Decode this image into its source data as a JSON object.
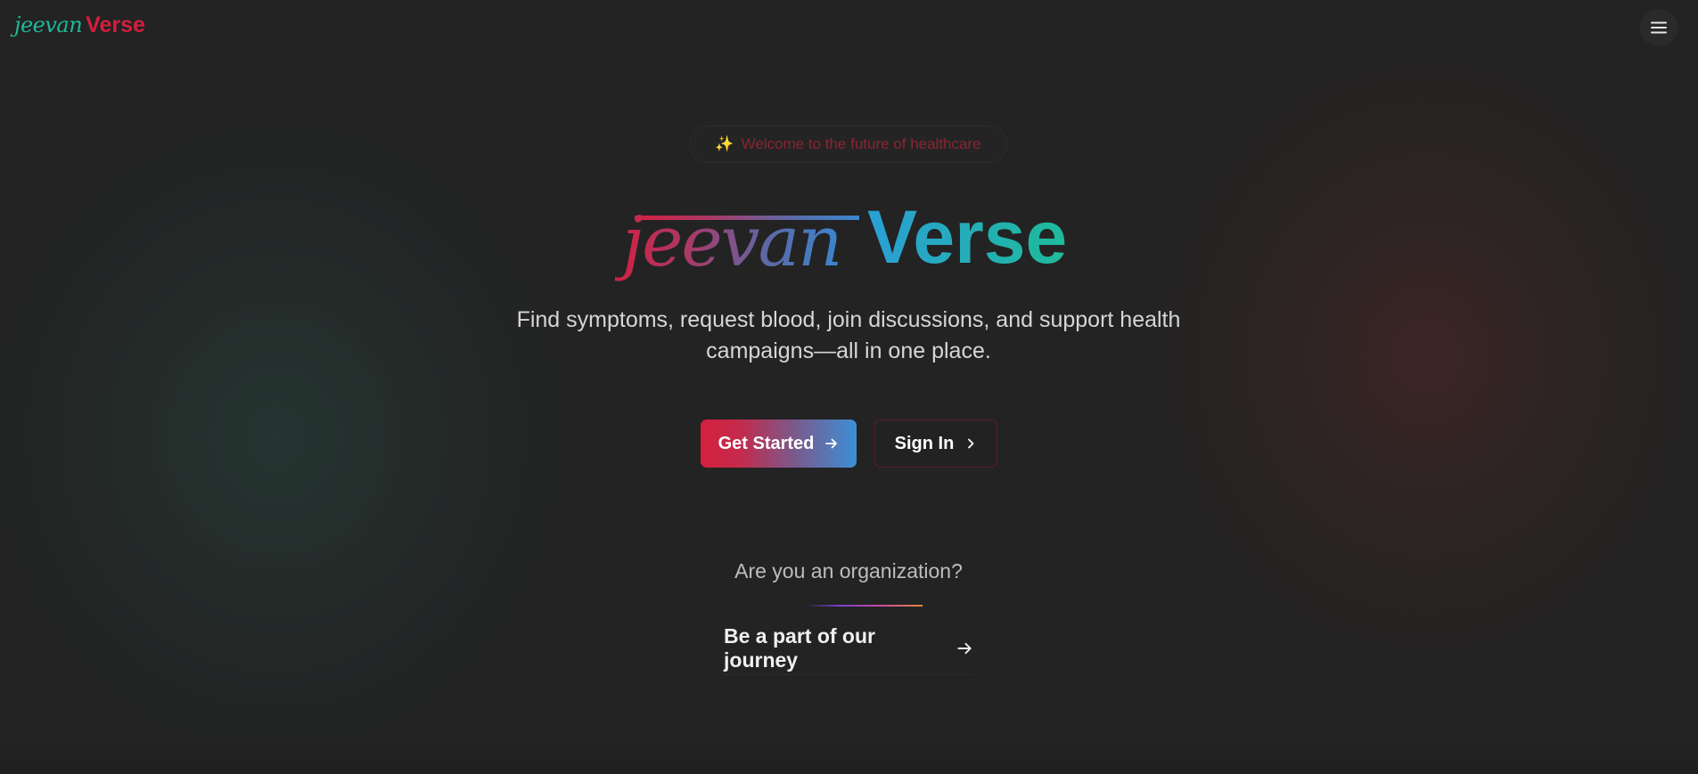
{
  "header": {
    "brand_part1": "jeevan",
    "brand_part2": "Verse",
    "menu_icon": "hamburger-menu-icon"
  },
  "hero": {
    "badge_icon": "sparkles-icon",
    "badge_emoji": "✨",
    "badge_text": "Welcome to the future of healthcare",
    "title_part1": "jeevan",
    "title_part2": "Verse",
    "tagline_line1": "Find symptoms, request blood, join discussions, and support health",
    "tagline_line2": "campaigns—all in one place.",
    "primary_cta_label": "Get Started",
    "primary_cta_icon": "arrow-right-icon",
    "secondary_cta_label": "Sign In",
    "secondary_cta_icon": "chevron-right-icon"
  },
  "organization": {
    "question": "Are you an organization?",
    "link_label": "Be a part of our journey",
    "link_icon": "arrow-right-icon"
  },
  "colors": {
    "background": "#232323",
    "brand_teal": "#1fb89a",
    "brand_red": "#d11f3c",
    "title_blue": "#2a9fd6"
  }
}
